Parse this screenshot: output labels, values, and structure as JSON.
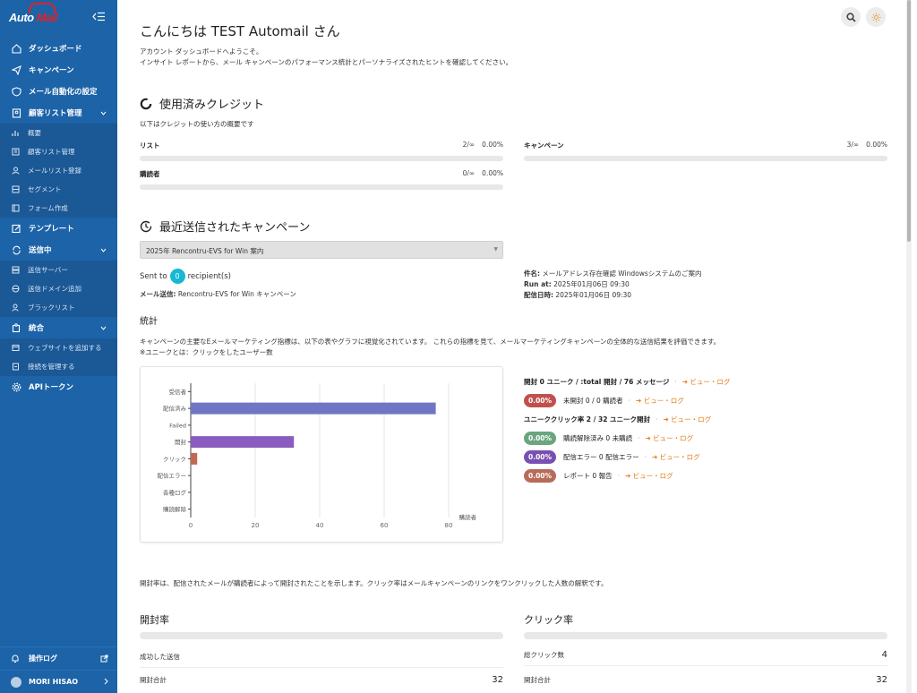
{
  "app": {
    "logo_text_prefix": "Auto ",
    "logo_text_suffix": "Mail"
  },
  "sidebar": {
    "items": [
      {
        "label": "ダッシュボード",
        "icon": "home-icon"
      },
      {
        "label": "キャンペーン",
        "icon": "paper-plane-icon"
      },
      {
        "label": "メール自動化の設定",
        "icon": "shield-icon"
      },
      {
        "label": "顧客リスト管理",
        "icon": "address-book-icon"
      },
      {
        "label": "テンプレート",
        "icon": "edit-icon"
      },
      {
        "label": "送信中",
        "icon": "sync-icon"
      },
      {
        "label": "統合",
        "icon": "puzzle-icon"
      },
      {
        "label": "APIトークン",
        "icon": "gear-icon"
      }
    ],
    "customer_sub": [
      "概要",
      "顧客リスト管理",
      "メールリスト登録",
      "セグメント",
      "フォーム作成"
    ],
    "sending_sub": [
      "送信サーバー",
      "送信ドメイン追加",
      "ブラックリスト"
    ],
    "integration_sub": [
      "ウェブサイトを追加する",
      "接続を管理する"
    ],
    "operation_log": "操作ログ",
    "user_name": "MORI HISAO"
  },
  "header": {
    "greeting": "こんにちは TEST Automail さん",
    "intro_line1": "アカウント ダッシュボードへようこそ。",
    "intro_line2": "インサイト レポートから、メール キャンペーンのパフォーマンス統計とパーソナライズされたヒントを確認してください。"
  },
  "credits": {
    "title": "使用済みクレジット",
    "caption": "以下はクレジットの使い方の概要です",
    "rows": [
      {
        "label": "リスト",
        "count": "2/∞",
        "percent": "0.00%",
        "fill": 0
      },
      {
        "label": "キャンペーン",
        "count": "3/∞",
        "percent": "0.00%",
        "fill": 0
      },
      {
        "label": "購読者",
        "count": "0/∞",
        "percent": "0.00%",
        "fill": 0
      }
    ]
  },
  "recent": {
    "title": "最近送信されたキャンペーン",
    "selected_campaign": "2025年 Rencontru-EVS for Win 案内",
    "sent_to_prefix": "Sent to",
    "sent_to_count": "0",
    "sent_to_suffix": "recipient(s)",
    "mail_send_label": "メール送信:",
    "mail_send_value": "Rencontru-EVS for Win キャンペーン",
    "subject_label": "件名:",
    "subject_value": "メールアドレス存在確認 Windowsシステムのご案内",
    "run_at_label": "Run at:",
    "run_at_value": "2025年01月06日 09:30",
    "delivered_label": "配信日時:",
    "delivered_value": "2025年01月06日 09:30"
  },
  "stats": {
    "title": "統計",
    "desc_line1": "キャンペーンの主要なEメールマーケティング指標は、以下の表やグラフに視覚化されています。 これらの指標を見て、メールマーケティングキャンペーンの全体的な送信結果を評価できます。",
    "desc_line2": "※ユニークとは：クリックをしたユーザー数"
  },
  "chart_data": {
    "type": "bar",
    "orientation": "horizontal",
    "categories": [
      "受信者",
      "配信済み",
      "Failed",
      "開封",
      "クリック",
      "配信エラー",
      "各種ログ",
      "購読解除"
    ],
    "values": [
      0,
      76,
      0,
      32,
      2,
      0,
      0,
      0
    ],
    "colors": [
      "#6f76c4",
      "#6f76c4",
      "#6f76c4",
      "#8a5cc0",
      "#c4674f",
      "#6f76c4",
      "#6f76c4",
      "#6f76c4"
    ],
    "xlim": [
      0,
      90
    ],
    "xticks": [
      0,
      20,
      40,
      60,
      80
    ],
    "xlabel": "購読者",
    "grid": true
  },
  "legend": {
    "open_line": {
      "text": "開封 0 ユニーク / :total 開封 / 76 メッセージ"
    },
    "unopened": {
      "percent": "0.00%",
      "text": "未開封 0 / 0 購読者",
      "color": "#c0504d"
    },
    "click_line": {
      "text": "ユニーククリック率 2 / 32 ユニーク開封"
    },
    "unsub": {
      "percent": "0.00%",
      "text": "購読解除済み 0 未購読",
      "color": "#6aa57e"
    },
    "error": {
      "percent": "0.00%",
      "text": "配信エラー 0 配信エラー",
      "color": "#7a4fb3"
    },
    "report": {
      "percent": "0.00%",
      "text": "レポート 0 報告",
      "color": "#b76b58"
    },
    "link_text": "ビュー・ログ",
    "sep": "·"
  },
  "bottom": {
    "note": "開封率は、配信されたメールが購読者によって開封されたことを示します。クリック率はメールキャンペーンのリンクをワンクリックした人数の解釈です。",
    "open_rate_title": "開封率",
    "click_rate_title": "クリック率",
    "success_label": "成功した送信",
    "open_total_label": "開封合計",
    "open_total_value": "32",
    "click_total_label": "総クリック数",
    "click_total_value": "4",
    "open_total_label_right": "開封合計",
    "open_total_value_right": "32"
  }
}
